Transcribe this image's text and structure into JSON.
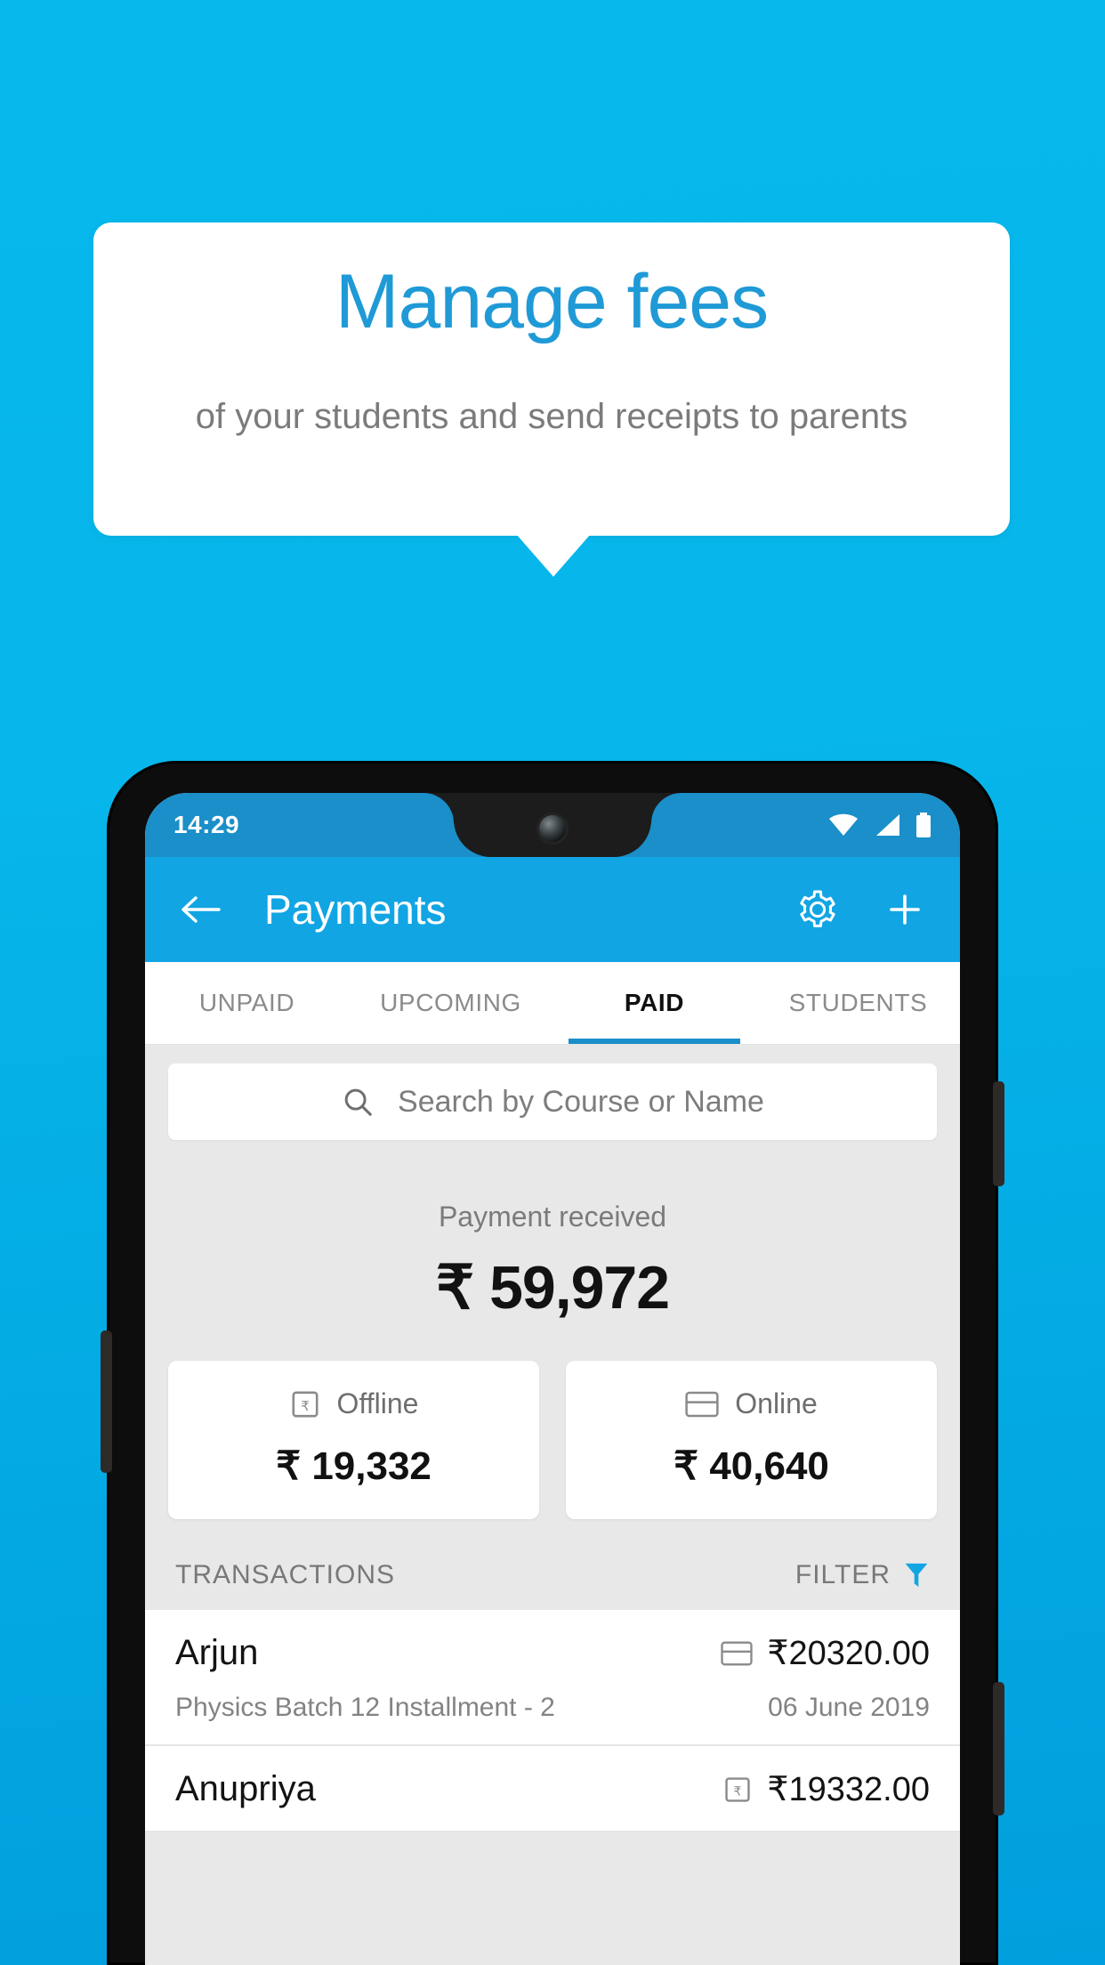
{
  "promo": {
    "title": "Manage fees",
    "subtitle": "of your students and send receipts to parents",
    "title_color": "#1f9ad6",
    "subtitle_color": "#7b7b7b"
  },
  "background": {
    "top_color": "#06b8ec",
    "bottom_color": "#019fdd"
  },
  "phone": {
    "status_bar": {
      "time": "14:29",
      "icons": [
        "wifi-icon",
        "signal-icon",
        "battery-icon"
      ],
      "background": "#1a8fc9"
    },
    "app_bar": {
      "back_icon": "arrow-left-icon",
      "title": "Payments",
      "settings_icon": "gear-icon",
      "add_icon": "plus-icon",
      "background": "#12a5e4"
    },
    "tabs": [
      {
        "label": "UNPAID",
        "active": false
      },
      {
        "label": "UPCOMING",
        "active": false
      },
      {
        "label": "PAID",
        "active": true
      },
      {
        "label": "STUDENTS",
        "active": false
      }
    ],
    "tab_indicator_color": "#1a8fc9",
    "search": {
      "icon": "search-icon",
      "placeholder": "Search by Course or Name",
      "value": ""
    },
    "summary": {
      "label": "Payment received",
      "amount": "₹ 59,972"
    },
    "method_cards": [
      {
        "icon": "receipt-rupee-icon",
        "label": "Offline",
        "amount": "₹ 19,332"
      },
      {
        "icon": "credit-card-icon",
        "label": "Online",
        "amount": "₹ 40,640"
      }
    ],
    "transactions_header": {
      "title": "TRANSACTIONS",
      "filter_label": "FILTER",
      "filter_icon": "filter-icon",
      "filter_icon_color": "#12a5e4"
    },
    "transactions": [
      {
        "name": "Arjun",
        "method_icon": "credit-card-icon",
        "amount": "₹20320.00",
        "description": "Physics Batch 12 Installment - 2",
        "date": "06 June 2019"
      },
      {
        "name": "Anupriya",
        "method_icon": "receipt-rupee-icon",
        "amount": "₹19332.00",
        "description": "",
        "date": ""
      }
    ]
  }
}
